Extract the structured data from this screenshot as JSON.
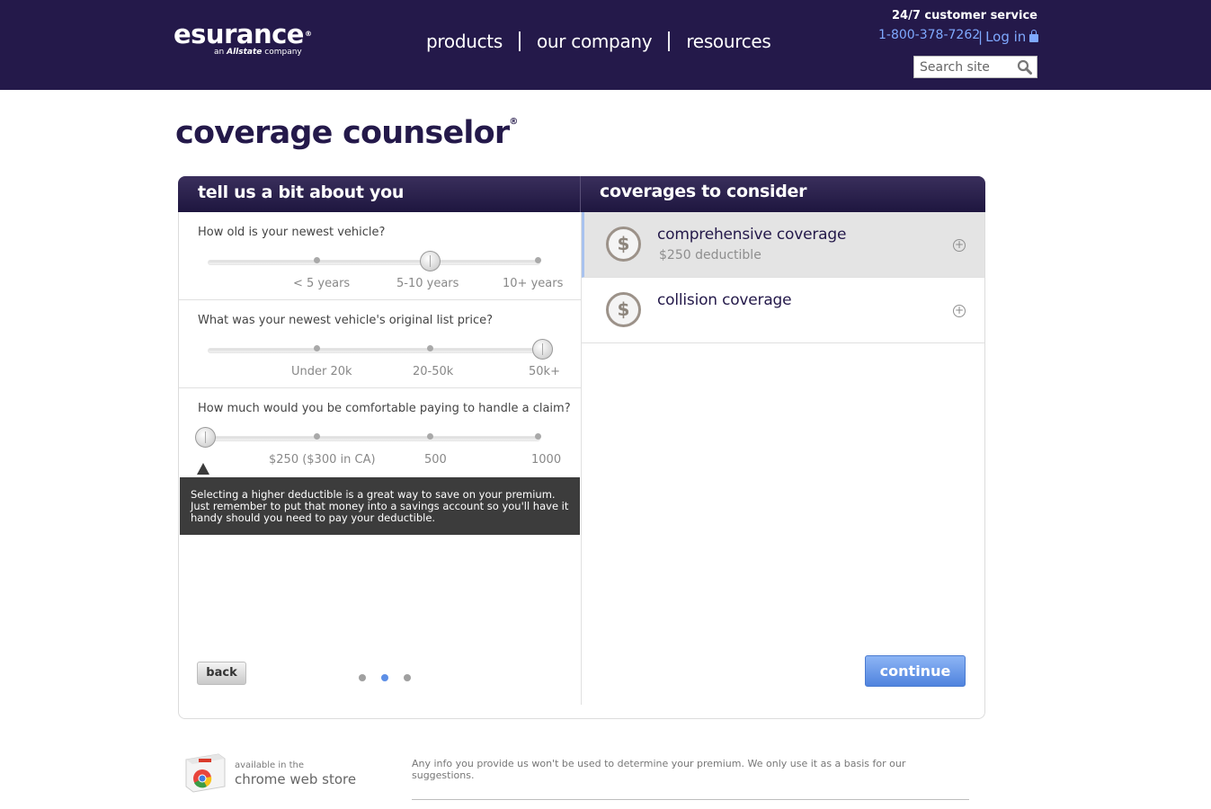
{
  "header": {
    "logo_text": "esurance",
    "logo_reg": "®",
    "logo_sub_prefix": "an",
    "logo_sub_brand": "Allstate",
    "logo_sub_suffix": "company",
    "nav": [
      "products",
      "our company",
      "resources"
    ],
    "customer_service": "24/7 customer service",
    "phone": "1-800-378-7262",
    "login_pipe": "|",
    "login": "Log in",
    "search_placeholder": "Search site"
  },
  "page": {
    "title": "coverage counselor",
    "title_reg": "®"
  },
  "left_panel": {
    "heading": "tell us a bit about you",
    "questions": [
      {
        "text": "How old is your newest vehicle?",
        "options": [
          "< 5 years",
          "5-10 years",
          "10+ years"
        ],
        "selected_index": 1
      },
      {
        "text": "What was your newest vehicle's original list price?",
        "options": [
          "Under 20k",
          "20-50k",
          "50k+"
        ],
        "selected_index": 2
      },
      {
        "text": "How much would you be comfortable paying to handle a claim?",
        "options": [
          "$250 ($300 in CA)",
          "500",
          "1000"
        ],
        "selected_index": -1
      }
    ],
    "tooltip": "Selecting a higher deductible is a great way to save on your premium. Just remember to put that money into a savings account so you'll have it handy should you need to pay your deductible.",
    "back_label": "back",
    "pager": {
      "count": 3,
      "active_index": 1
    }
  },
  "right_panel": {
    "heading": "coverages to consider",
    "coverages": [
      {
        "title": "comprehensive coverage",
        "detail": "$250 deductible",
        "icon": "dollar-icon",
        "selected": true
      },
      {
        "title": "collision coverage",
        "detail": "",
        "icon": "dollar-icon",
        "selected": false
      }
    ],
    "continue_label": "continue"
  },
  "footer": {
    "chrome_small": "available in the",
    "chrome_big": "chrome web store",
    "disclaimer": "Any info you provide us won't be used to determine your premium. We only use it as a basis for our suggestions."
  },
  "colors": {
    "brand_dark": "#24194a",
    "link_blue": "#7fa9ff",
    "accent_blue": "#5d8fe6"
  }
}
